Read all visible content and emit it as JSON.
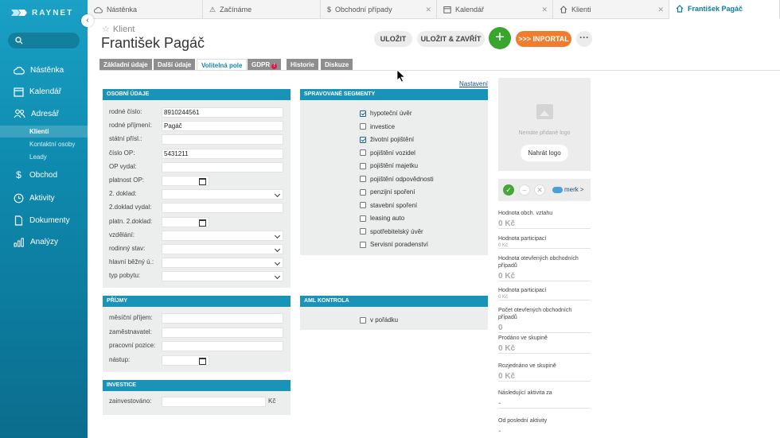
{
  "app": {
    "brand": "RAYNET"
  },
  "sidebar": {
    "search_icon": "search-icon",
    "items": [
      {
        "label": "Nástěnka",
        "icon": "cloud-icon"
      },
      {
        "label": "Kalendář",
        "icon": "calendar-icon"
      },
      {
        "label": "Adresář",
        "icon": "users-icon"
      },
      {
        "label": "Obchod",
        "icon": "dollar-icon"
      },
      {
        "label": "Aktivity",
        "icon": "clock-icon"
      },
      {
        "label": "Dokumenty",
        "icon": "document-icon"
      },
      {
        "label": "Analýzy",
        "icon": "chart-icon"
      }
    ],
    "subitems": [
      {
        "label": "Klienti",
        "active": true
      },
      {
        "label": "Kontaktní osoby",
        "active": false
      },
      {
        "label": "Leady",
        "active": false
      }
    ]
  },
  "tabs": [
    {
      "label": "Nástěnka",
      "icon": "cloud-icon"
    },
    {
      "label": "Začínáme",
      "icon": "warning-icon"
    },
    {
      "label": "Obchodní případy",
      "icon": "dollar-icon"
    },
    {
      "label": "Kalendář",
      "icon": "calendar-icon"
    },
    {
      "label": "Klienti",
      "icon": "home-icon"
    },
    {
      "label": "František Pagáč",
      "icon": "home-icon",
      "active": true
    }
  ],
  "header": {
    "breadcrumb": "Klient",
    "title": "František Pagáč",
    "save": "ULOŽIT",
    "save_close": "ULOŽIT & ZAVŘÍT",
    "add": "+",
    "inportal": ">>> INPORTAL",
    "more": "···"
  },
  "section_tabs": [
    {
      "label": "Základní údaje"
    },
    {
      "label": "Další údaje"
    },
    {
      "label": "Volitelná pole",
      "active": true
    },
    {
      "label": "GDPR",
      "badge": "!"
    },
    {
      "label": "Historie"
    },
    {
      "label": "Diskuze"
    }
  ],
  "settings_link": "Nastavení",
  "personal": {
    "title": "OSOBNÍ ÚDAJE",
    "fields": [
      {
        "label": "rodné číslo:",
        "value": "8910244561",
        "kind": "text"
      },
      {
        "label": "rodné příjmení:",
        "value": "Pagáč",
        "kind": "text"
      },
      {
        "label": "státní přísl.:",
        "value": "",
        "kind": "text"
      },
      {
        "label": "číslo OP:",
        "value": "5431211",
        "kind": "text"
      },
      {
        "label": "OP vydal:",
        "value": "",
        "kind": "text"
      },
      {
        "label": "platnost OP:",
        "value": "",
        "kind": "date"
      },
      {
        "label": "2. doklad:",
        "value": "",
        "kind": "select"
      },
      {
        "label": "2.doklad vydal:",
        "value": "",
        "kind": "text"
      },
      {
        "label": "platn. 2.doklad:",
        "value": "",
        "kind": "date"
      },
      {
        "label": "vzdělání:",
        "value": "",
        "kind": "select"
      },
      {
        "label": "rodinný stav:",
        "value": "",
        "kind": "select"
      },
      {
        "label": "hlavní běžný ú.:",
        "value": "",
        "kind": "select"
      },
      {
        "label": "typ pobytu:",
        "value": "",
        "kind": "select"
      }
    ]
  },
  "income": {
    "title": "PŘÍJMY",
    "fields": [
      {
        "label": "měsíční příjem:",
        "value": "",
        "kind": "text"
      },
      {
        "label": "zaměstnavatel:",
        "value": "",
        "kind": "text"
      },
      {
        "label": "pracovní pozice:",
        "value": "",
        "kind": "text"
      },
      {
        "label": "nástup:",
        "value": "",
        "kind": "date"
      }
    ]
  },
  "investment": {
    "title": "INVESTICE",
    "label": "zainvestováno:",
    "value": "",
    "unit": "Kč"
  },
  "segments": {
    "title": "SPRAVOVANÉ SEGMENTY",
    "items": [
      {
        "label": "hypoteční úvěr",
        "checked": true
      },
      {
        "label": "investice",
        "checked": false
      },
      {
        "label": "životní pojištění",
        "checked": true
      },
      {
        "label": "pojištění vozidel",
        "checked": false
      },
      {
        "label": "pojištění majetku",
        "checked": false
      },
      {
        "label": "pojištění odpovědnosti",
        "checked": false
      },
      {
        "label": "penzijní spoření",
        "checked": false
      },
      {
        "label": "stavební spoření",
        "checked": false
      },
      {
        "label": "leasing auto",
        "checked": false
      },
      {
        "label": "spotřebitelský úvěr",
        "checked": false
      },
      {
        "label": "Servisní poradenství",
        "checked": false
      }
    ]
  },
  "aml": {
    "title": "AML KONTROLA",
    "items": [
      {
        "label": "v pořádku",
        "checked": false
      }
    ]
  },
  "logo": {
    "no_logo": "Nemáte přidané logo",
    "upload": "Nahrát logo"
  },
  "merk": {
    "label": "merk",
    "chevron": ">"
  },
  "stats": [
    {
      "label": "Hodnota obch. vztahu",
      "value": "0 Kč",
      "sub": ""
    },
    {
      "label": "Hodnota participací",
      "value": "",
      "sub": "0 Kč"
    },
    {
      "label": "Hodnota otevřených obchodních případů",
      "value": "0 Kč",
      "sub": ""
    },
    {
      "label": "Hodnota participací",
      "value": "",
      "sub": "0 Kč"
    },
    {
      "label": "Počet otevřených obchodních případů",
      "value": "0",
      "sub": ""
    },
    {
      "label": "Prodáno ve skupině",
      "value": "0 Kč",
      "sub": ""
    },
    {
      "label": "Rozjednáno ve skupině",
      "value": "0 Kč",
      "sub": ""
    },
    {
      "label": "Následující aktivita za",
      "value": "-",
      "sub": ""
    },
    {
      "label": "Od poslední aktivity",
      "value": "-",
      "sub": ""
    }
  ]
}
